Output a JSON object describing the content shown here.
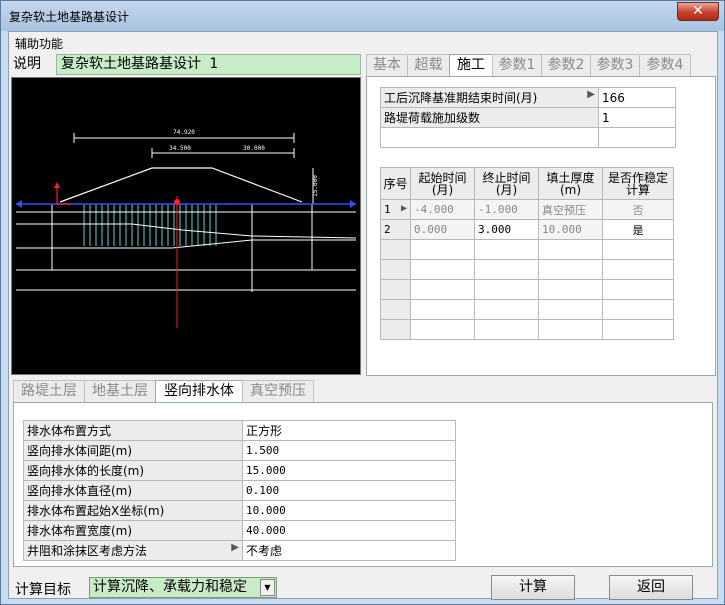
{
  "window": {
    "title": "复杂软土地基路基设计",
    "close_glyph": "✕"
  },
  "menu": {
    "item": "辅助功能"
  },
  "description": {
    "label": "说明",
    "value": "复杂软土地基路基设计 1"
  },
  "drawing": {
    "dim_total": "74.920",
    "dim_left": "34.500",
    "dim_right": "30.000",
    "dim_height": "15.000",
    "colors": {
      "line": "#ffffff",
      "drain": "#5ad4d4",
      "axis": "#ff2020",
      "water": "#3050ff"
    }
  },
  "top_tabs": [
    "基本",
    "超载",
    "施工",
    "参数1",
    "参数2",
    "参数3",
    "参数4"
  ],
  "construction": {
    "rows": [
      {
        "label": "工后沉降基准期结束时间(月)",
        "value": "166"
      },
      {
        "label": "路堤荷载施加级数",
        "value": "1"
      },
      {
        "label": "",
        "value": ""
      }
    ],
    "stage_headers": [
      "序号",
      "起始时间(月)",
      "终止时间(月)",
      "填土厚度(m)",
      "是否作稳定计算"
    ],
    "stages": [
      {
        "no": "1",
        "start": "-4.000",
        "end": "-1.000",
        "fill": "真空预压",
        "stability": "否"
      },
      {
        "no": "2",
        "start": "0.000",
        "end": "3.000",
        "fill": "10.000",
        "stability": "是"
      }
    ]
  },
  "bottom_tabs": [
    "路堤土层",
    "地基土层",
    "竖向排水体",
    "真空预压"
  ],
  "drainage": [
    {
      "label": "排水体布置方式",
      "value": "正方形"
    },
    {
      "label": "竖向排水体间距(m)",
      "value": "1.500"
    },
    {
      "label": "竖向排水体的长度(m)",
      "value": "15.000"
    },
    {
      "label": "竖向排水体直径(m)",
      "value": "0.100"
    },
    {
      "label": "排水体布置起始X坐标(m)",
      "value": "10.000"
    },
    {
      "label": "排水体布置宽度(m)",
      "value": "40.000"
    },
    {
      "label": "井阻和涂抹区考虑方法",
      "value": "不考虑"
    }
  ],
  "footer": {
    "target_label": "计算目标",
    "target_value": "计算沉降、承载力和稳定",
    "calc_button": "计算",
    "back_button": "返回"
  }
}
